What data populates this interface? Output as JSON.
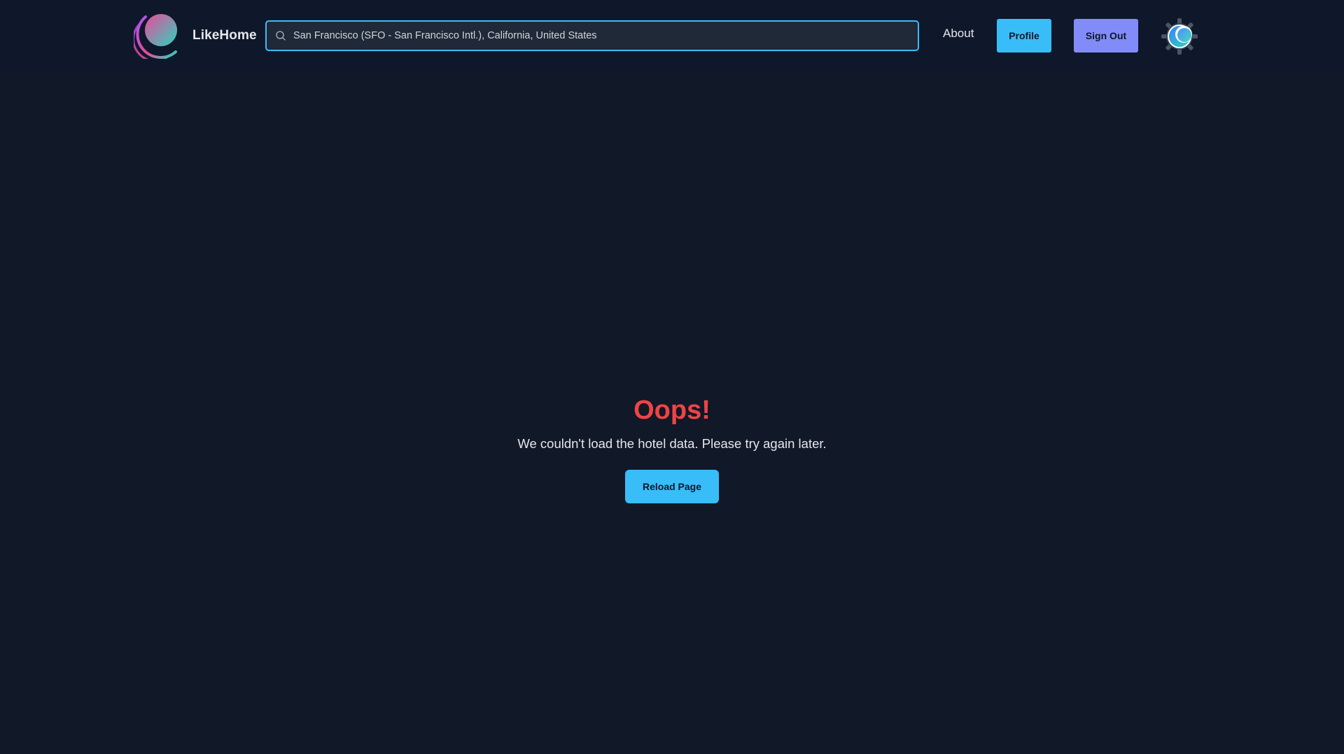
{
  "header": {
    "brand_name": "LikeHome",
    "search": {
      "value": "San Francisco (SFO - San Francisco Intl.), California, United States",
      "placeholder": ""
    },
    "nav": {
      "about_label": "About",
      "profile_label": "Profile",
      "signout_label": "Sign Out"
    },
    "icons": {
      "logo": "likehome-logo-icon",
      "search": "search-icon",
      "theme": "theme-toggle-icon"
    }
  },
  "error": {
    "title": "Oops!",
    "message": "We couldn't load the hotel data. Please try again later.",
    "reload_label": "Reload Page"
  },
  "colors": {
    "background": "#111827",
    "navbar": "#0f172a",
    "accent": "#38bdf8",
    "secondary_accent": "#818cf8",
    "error": "#ef4444",
    "logo_pink": "#ec4899",
    "logo_teal": "#2dd4bf"
  }
}
